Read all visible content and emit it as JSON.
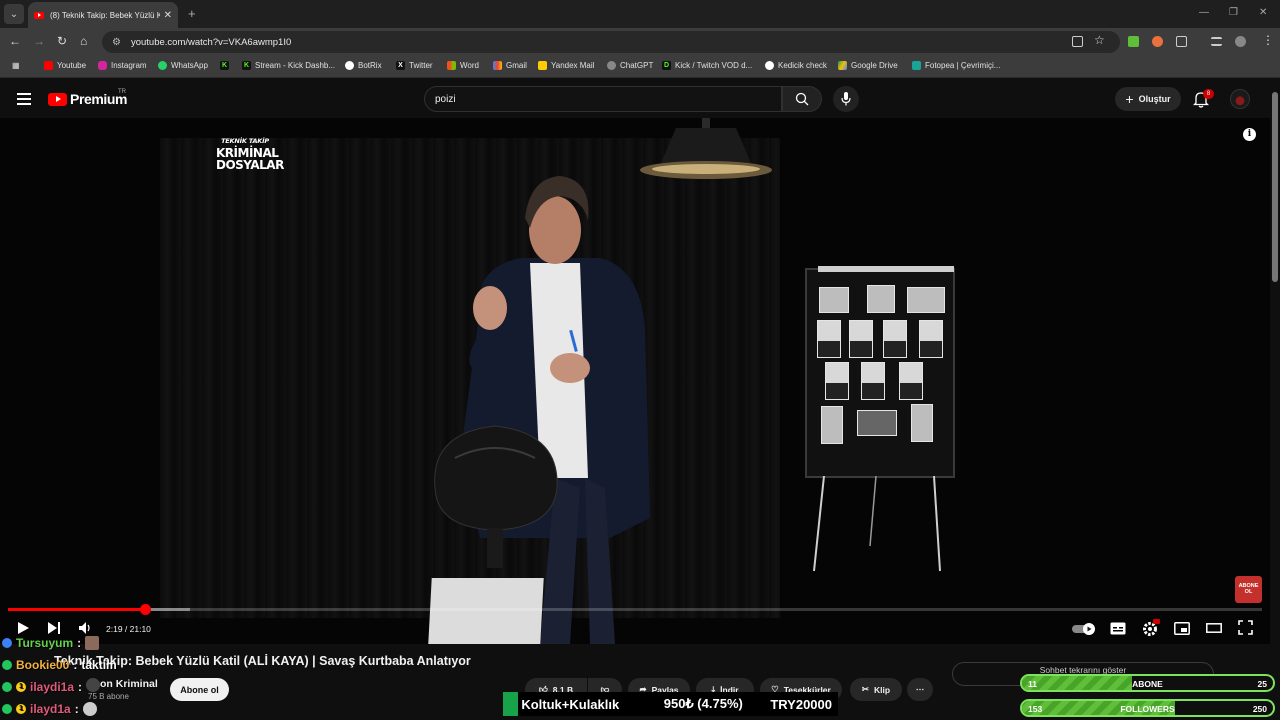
{
  "browser": {
    "tab_title": "(8) Teknik Takip: Bebek Yüzlü Ka",
    "url": "youtube.com/watch?v=VKA6awmp1I0",
    "bookmarks": [
      {
        "label": "Youtube",
        "color": "#ff0000"
      },
      {
        "label": "Instagram",
        "color": "#d6249f"
      },
      {
        "label": "WhatsApp",
        "color": "#25d366"
      },
      {
        "label": "",
        "color": "#53fc18",
        "glyph": "K"
      },
      {
        "label": "Stream - Kick Dashb...",
        "color": "#53fc18",
        "glyph": "K"
      },
      {
        "label": "BotRix",
        "color": "#ffffff"
      },
      {
        "label": "Twitter",
        "color": "#111111",
        "glyph": "X"
      },
      {
        "label": "Word",
        "color": "#f25022"
      },
      {
        "label": "Gmail",
        "color": "#ea4335"
      },
      {
        "label": "Yandex Mail",
        "color": "#ffcc00"
      },
      {
        "label": "ChatGPT",
        "color": "#10a37f"
      },
      {
        "label": "Kick / Twitch VOD d...",
        "color": "#53fc18",
        "glyph": "D"
      },
      {
        "label": "Kedicik check",
        "color": "#ffffff"
      },
      {
        "label": "Google Drive",
        "color": "#4285f4"
      },
      {
        "label": "Fotopea | Çevrimiçi...",
        "color": "#18a497"
      }
    ]
  },
  "youtube": {
    "logo_text": "Premium",
    "country": "TR",
    "search_value": "poizi",
    "create_label": "Oluştur",
    "notification_count": "8"
  },
  "video": {
    "brand_line1": "TEKNİK TAKİP",
    "brand_line2": "KRİMİNAL",
    "brand_line3": "DOSYALAR",
    "abone_line1": "ABONE",
    "abone_line2": "OL",
    "time_display": "2:19 / 21:10",
    "progress_played": 0.109,
    "progress_buffered": 0.145,
    "title": "Teknik Takip: Bebek Yüzlü Katil (ALİ KAYA) | Savaş Kurtbaba Anlatıyor"
  },
  "channel": {
    "name": "Teknik Takip Kriminal",
    "name_visible": "on Kriminal",
    "subscribers": "75 B abone",
    "subscribe_label": "Abone ol"
  },
  "actions": {
    "likes": "8,1 B",
    "share": "Paylaş",
    "download": "İndir",
    "thanks": "Teşekkürler",
    "clip": "Klip"
  },
  "chat_panel_label": "Sohbet tekrarını göster",
  "stream_overlay": {
    "chat": [
      {
        "user": "Tursuyum",
        "message": "",
        "color": "#63d14b",
        "badge_color": "#3b82f6"
      },
      {
        "user": "Bookie00",
        "message": "taktim",
        "color": "#f5b041",
        "badge_color": "#22c55e"
      },
      {
        "user": "ilaydi1a",
        "message": "",
        "color": "#e05a7a",
        "badge_color": "#facc15",
        "badge_glyph": "1"
      },
      {
        "user": "ilayd1a",
        "message": "",
        "color": "#e05a7a",
        "badge_color": "#facc15",
        "badge_glyph": "1"
      }
    ],
    "goal": {
      "label": "Koltuk+Kulaklık",
      "progress": "950₺ (4.75%)",
      "target": "TRY20000"
    },
    "stats": [
      {
        "left": "11",
        "label": "ABONE",
        "right": "25",
        "fill": 0.44
      },
      {
        "left": "153",
        "label": "FOLLOWERS",
        "right": "250",
        "fill": 0.61
      }
    ]
  }
}
